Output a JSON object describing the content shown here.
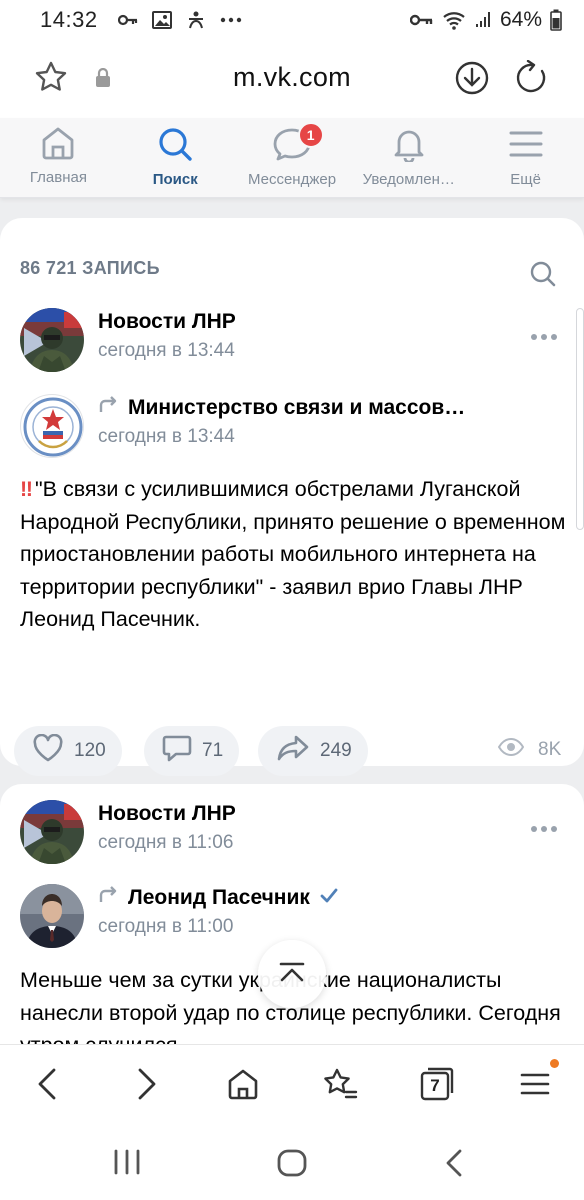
{
  "status_bar": {
    "time": "14:32",
    "battery": "64%",
    "icons": [
      "key-icon",
      "gallery-icon",
      "accessibility-icon",
      "more-dots-icon",
      "vpn-key-icon",
      "wifi-icon",
      "signal-icon",
      "battery-icon"
    ]
  },
  "browser": {
    "domain": "m.vk.com",
    "icons": [
      "star-icon",
      "lock-icon",
      "download-icon",
      "reload-icon"
    ]
  },
  "vk_nav": {
    "tabs": [
      {
        "label": "Главная",
        "icon": "home-icon"
      },
      {
        "label": "Поиск",
        "icon": "search-icon",
        "active": true
      },
      {
        "label": "Мессенджер",
        "icon": "chat-icon",
        "badge": "1"
      },
      {
        "label": "Уведомлен…",
        "icon": "bell-icon"
      },
      {
        "label": "Ещё",
        "icon": "menu-icon"
      }
    ]
  },
  "feed": {
    "count_label": "86 721 ЗАПИСЬ",
    "posts": [
      {
        "author": "Новости ЛНР",
        "time": "сегодня в 13:44",
        "repost_author": "Министерство связи и массов…",
        "repost_time": "сегодня в 13:44",
        "text_prefix": "‼",
        "text": "\"В связи с усилившимися обстрелами Луганской Народной Республики, принято решение о временном приостановлении работы мобильного интернета на территории республики\" - заявил врио Главы ЛНР Леонид Пасечник.",
        "likes": "120",
        "comments": "71",
        "shares": "249",
        "views": "8K"
      },
      {
        "author": "Новости ЛНР",
        "time": "сегодня в 11:06",
        "repost_author": "Леонид Пасечник",
        "repost_time": "сегодня в 11:00",
        "text": "Меньше чем за сутки украинские националисты нанесли второй удар по столице республики. Сегодня утром случился"
      }
    ]
  },
  "bottom_bar": {
    "tabs_count": "7",
    "icons": [
      "back-icon",
      "forward-icon",
      "home-icon",
      "bookmarks-icon",
      "tabs-icon",
      "menu-icon"
    ]
  },
  "colors": {
    "vk_active": "#2a5885",
    "vk_blue": "#2b78d6",
    "badge_red": "#e64646",
    "muted": "#818c99",
    "menu_dot": "#ee7a23"
  }
}
